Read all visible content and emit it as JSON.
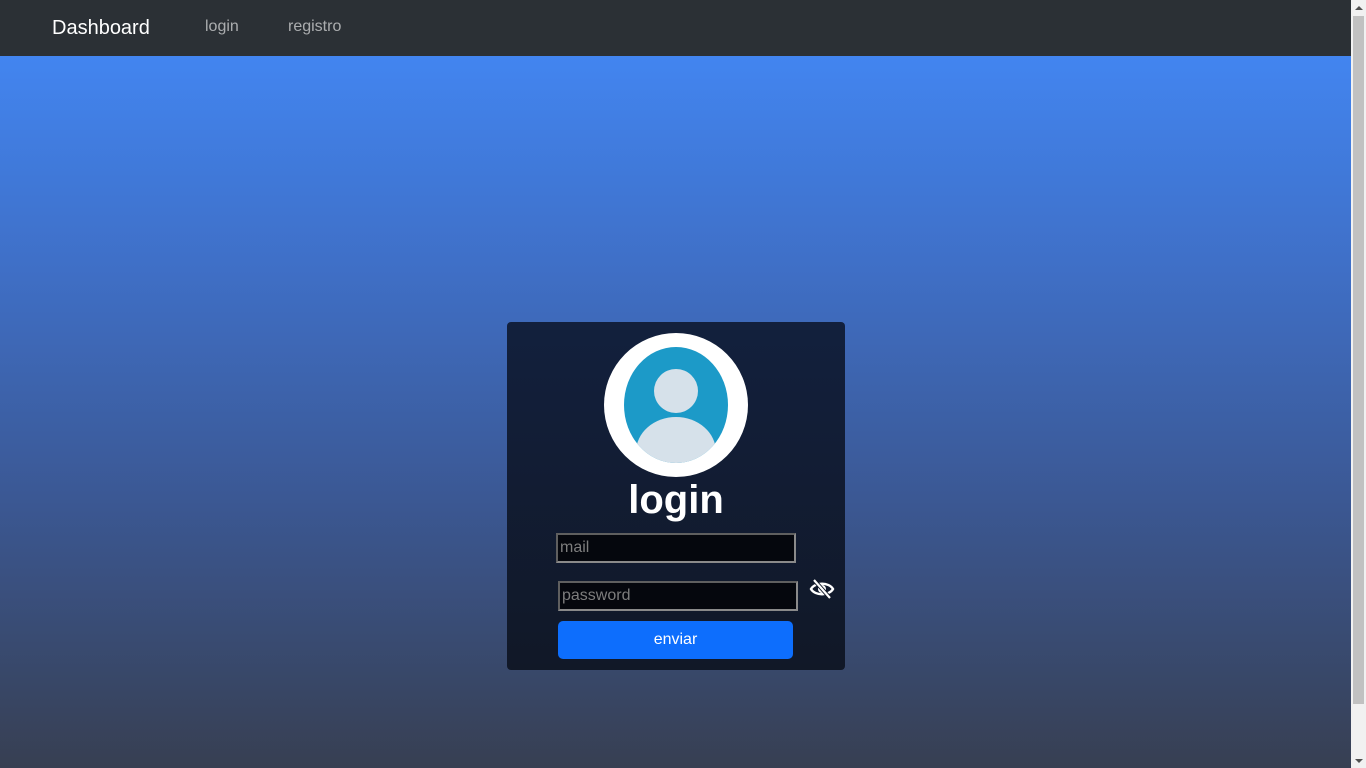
{
  "navbar": {
    "brand": "Dashboard",
    "links": [
      {
        "label": "login"
      },
      {
        "label": "registro"
      }
    ]
  },
  "login_card": {
    "title": "login",
    "mail_placeholder": "mail",
    "password_placeholder": "password",
    "submit_label": "enviar",
    "visibility_icon": "eye-slash-icon",
    "avatar_icon": "user-avatar-icon"
  },
  "colors": {
    "navbar_bg": "#2b3035",
    "gradient_top": "#4285f0",
    "gradient_bottom": "#373f52",
    "card_bg": "#111827",
    "avatar_bg": "#1c9ac8",
    "button_bg": "#0d6efd"
  }
}
